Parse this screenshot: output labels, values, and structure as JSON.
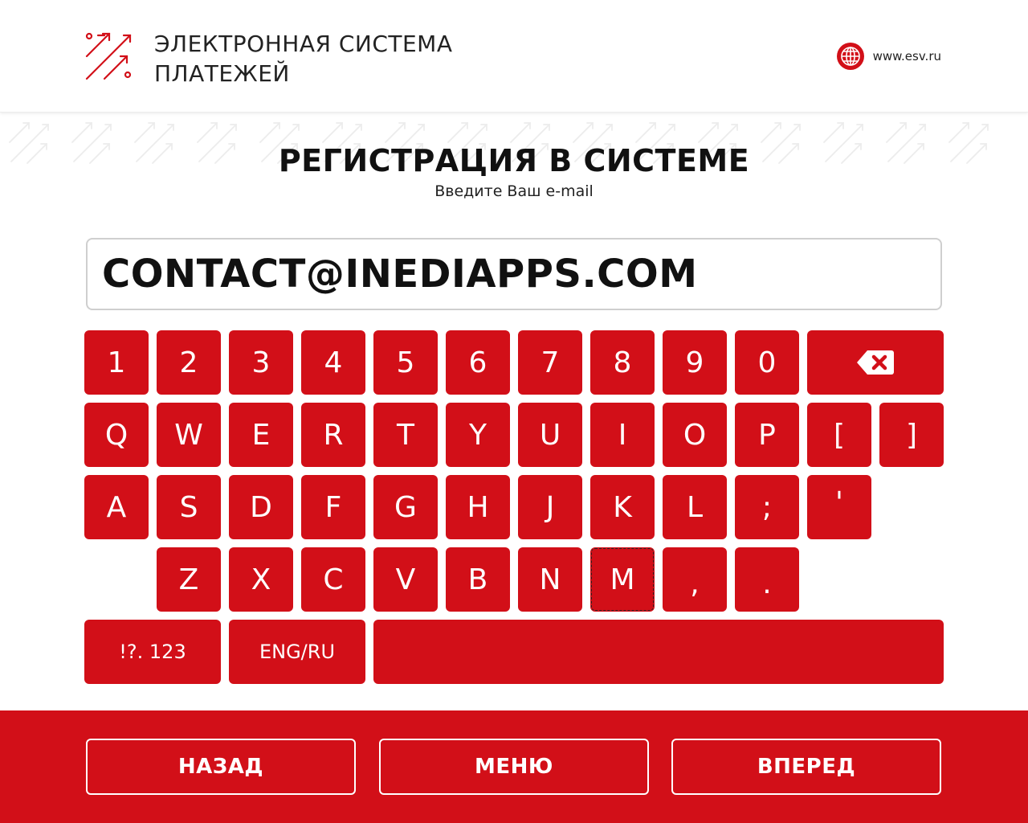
{
  "header": {
    "logo_line1": "ЭЛЕКТРОННАЯ СИСТЕМА",
    "logo_line2": "ПЛАТЕЖЕЙ",
    "site_url": "www.esv.ru"
  },
  "main": {
    "title": "РЕГИСТРАЦИЯ В СИСТЕМЕ",
    "subtitle": "Введите Ваш e-mail",
    "email_value": "CONTACT@INEDIAPPS.COM"
  },
  "keyboard": {
    "row1": [
      "1",
      "2",
      "3",
      "4",
      "5",
      "6",
      "7",
      "8",
      "9",
      "0"
    ],
    "backspace_icon": "backspace-icon",
    "row2": [
      "Q",
      "W",
      "E",
      "R",
      "T",
      "Y",
      "U",
      "I",
      "O",
      "P",
      "[",
      "]"
    ],
    "row3": [
      "A",
      "S",
      "D",
      "F",
      "G",
      "H",
      "J",
      "K",
      "L",
      ";",
      "'"
    ],
    "row4": [
      "Z",
      "X",
      "C",
      "V",
      "B",
      "N",
      "M",
      ",",
      "."
    ],
    "symbols_label": "!?. 123",
    "lang_label": "ENG/RU",
    "space_label": ""
  },
  "footer": {
    "back_label": "НАЗАД",
    "menu_label": "МЕНЮ",
    "forward_label": "ВПЕРЕД"
  },
  "colors": {
    "accent": "#d20f18",
    "text": "#111111",
    "background": "#ffffff"
  }
}
